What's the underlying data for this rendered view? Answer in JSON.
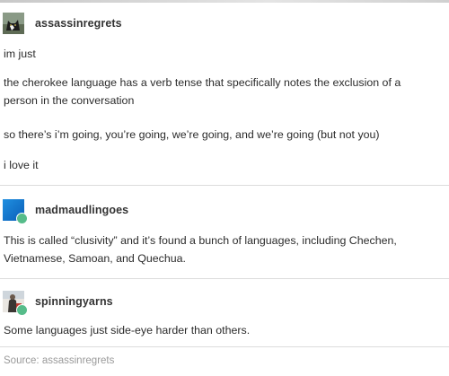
{
  "posts": [
    {
      "username": "assassinregrets",
      "avatar_icon": "cat-avatar",
      "paragraphs": [
        "im just",
        "the cherokee language has a verb tense that specifically notes the exclusion of a",
        "person in the conversation",
        "so there’s i’m going, you’re going, we’re going, and we’re going (but not you)",
        "i love it"
      ]
    },
    {
      "username": "madmaudlingoes",
      "avatar_icon": "blue-square-avatar",
      "paragraphs": [
        "This is called “clusivity” and it’s found a bunch of languages, including Chechen,",
        "Vietnamese, Samoan, and Quechua."
      ]
    },
    {
      "username": "spinningyarns",
      "avatar_icon": "yarn-avatar",
      "paragraphs": [
        "Some languages just side-eye harder than others."
      ]
    }
  ],
  "source": {
    "label": "Source: assassinregrets"
  },
  "colors": {
    "reblog_badge": "#56bc8a",
    "divider": "#dcdcdc",
    "source_text": "#9a9a9a"
  }
}
